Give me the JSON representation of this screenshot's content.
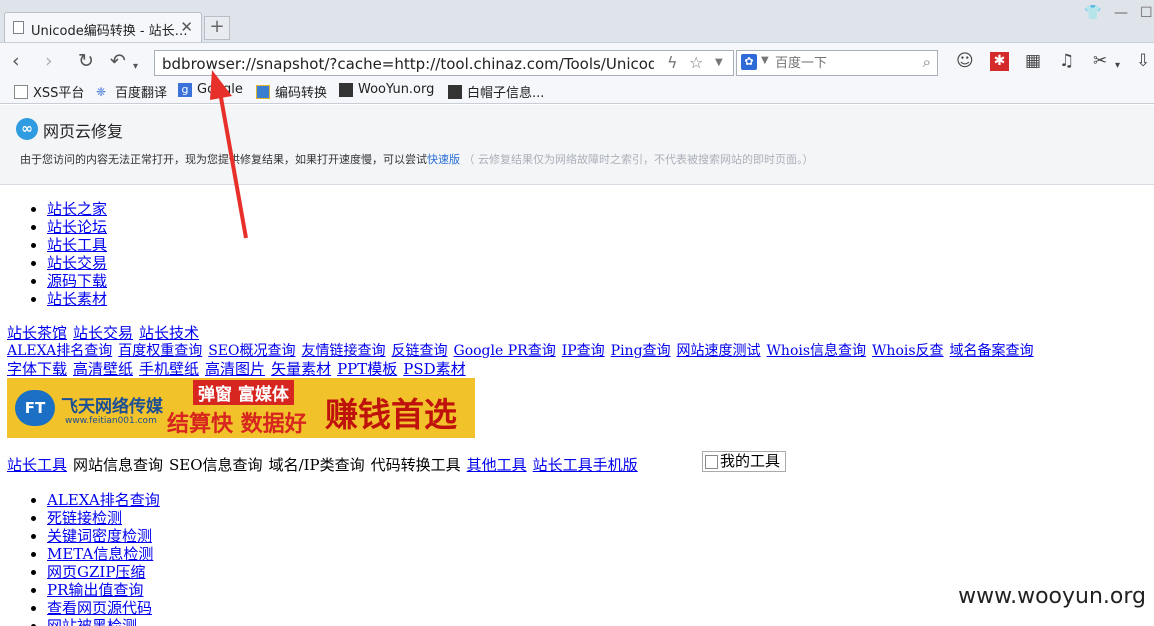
{
  "browser": {
    "tab_title": "Unicode编码转换 - 站长…",
    "new_tab_label": "+",
    "url": "bdbrowser://snapshot/?cache=http://tool.chinaz.com/Tools/Unicode.aspx",
    "search_placeholder": "百度一下",
    "bookmarks": [
      "XSS平台",
      "百度翻译",
      "Google",
      "编码转换",
      "WooYun.org",
      "白帽子信息..."
    ]
  },
  "notice": {
    "title": "网页云修复",
    "message": "由于您访问的内容无法正常打开，现为您提供修复结果，如果打开速度慢，可以尝试",
    "fast_link": "快速版",
    "disclaimer": "（ 云修复结果仅为网络故障时之索引，不代表被搜索网站的即时页面。）"
  },
  "page": {
    "top_nav": [
      "站长之家",
      "站长论坛",
      "站长工具",
      "站长交易",
      "源码下载",
      "站长素材"
    ],
    "row1": [
      "站长茶馆",
      "站长交易",
      "站长技术"
    ],
    "row2": [
      "ALEXA排名查询",
      "百度权重查询",
      "SEO概况查询",
      "友情链接查询",
      "反链查询",
      "Google PR查询",
      "IP查询",
      "Ping查询",
      "网站速度测试",
      "Whois信息查询",
      "Whois反查",
      "域名备案查询"
    ],
    "row3": [
      "字体下载",
      "高清壁纸",
      "手机壁纸",
      "高清图片",
      "矢量素材",
      "PPT模板",
      "PSD素材"
    ],
    "banner": {
      "company": "飞天网络传媒",
      "site": "www.feitian001.com",
      "popup": "弹窗 富媒体",
      "slogan": "结算快 数据好",
      "cta": "赚钱首选",
      "logo": "FT"
    },
    "category_bar": [
      {
        "label": "站长工具",
        "link": true
      },
      {
        "label": "网站信息查询",
        "link": false
      },
      {
        "label": "SEO信息查询",
        "link": false
      },
      {
        "label": "域名/IP类查询",
        "link": false
      },
      {
        "label": "代码转换工具",
        "link": false
      },
      {
        "label": "其他工具",
        "link": true
      },
      {
        "label": "站长工具手机版",
        "link": true
      }
    ],
    "my_tools_alt": "我的工具",
    "tool_list": [
      "ALEXA排名查询",
      "死链接检测",
      "关键词密度检测",
      "META信息检测",
      "网页GZIP压缩",
      "PR输出值查询",
      "查看网页源代码",
      "网站被黑检测"
    ]
  },
  "watermark": "www.wooyun.org",
  "colors": {
    "link": "#0000ee",
    "arrow": "#e8302a",
    "notice_link": "#2a6fd6"
  }
}
